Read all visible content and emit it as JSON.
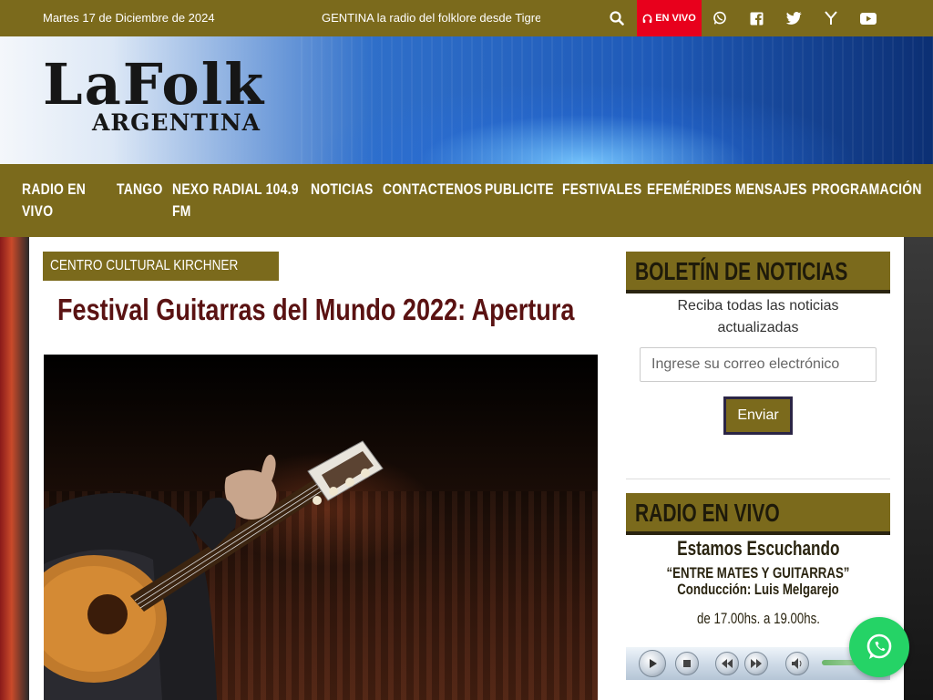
{
  "topbar": {
    "date": "Martes 17 de Diciembre de 2024",
    "ticker": "GENTINA la radio del folklore desde Tigre",
    "live_label": "EN VIVO",
    "icons": [
      "search-icon",
      "whatsapp-icon",
      "facebook-icon",
      "twitter-icon",
      "ycombinator-icon",
      "youtube-icon"
    ]
  },
  "logo": {
    "line1": "LaFolk",
    "line2": "ARGENTINA"
  },
  "nav": {
    "items": [
      {
        "label": "RADIO EN"
      },
      {
        "label": "VIVO"
      },
      {
        "label": "TANGO"
      },
      {
        "label": "NEXO RADIAL 104.9"
      },
      {
        "label": "FM"
      },
      {
        "label": "NOTICIAS"
      },
      {
        "label": "CONTACTENOS"
      },
      {
        "label": "PUBLICITE"
      },
      {
        "label": "FESTIVALES"
      },
      {
        "label": "EFEMÉRIDES"
      },
      {
        "label": "MENSAJES"
      },
      {
        "label": "PROGRAMACIÓN"
      }
    ]
  },
  "post": {
    "category": "CENTRO CULTURAL KIRCHNER",
    "title": "Festival Guitarras del Mundo 2022: Apertura"
  },
  "newsletter": {
    "heading": "BOLETÍN DE NOTICIAS",
    "text": "Reciba todas las noticias actualizadas",
    "placeholder": "Ingrese su correo electrónico",
    "button": "Enviar"
  },
  "radio": {
    "heading": "RADIO EN VIVO",
    "listening": "Estamos Escuchando",
    "program": "“ENTRE MATES Y GUITARRAS” Conducción: Luis Melgarejo",
    "schedule": "de 17.00hs. a 19.00hs."
  },
  "colors": {
    "brand": "#7b6a1c",
    "live": "#e8001c",
    "title": "#5a1212",
    "whatsapp": "#25d366"
  }
}
